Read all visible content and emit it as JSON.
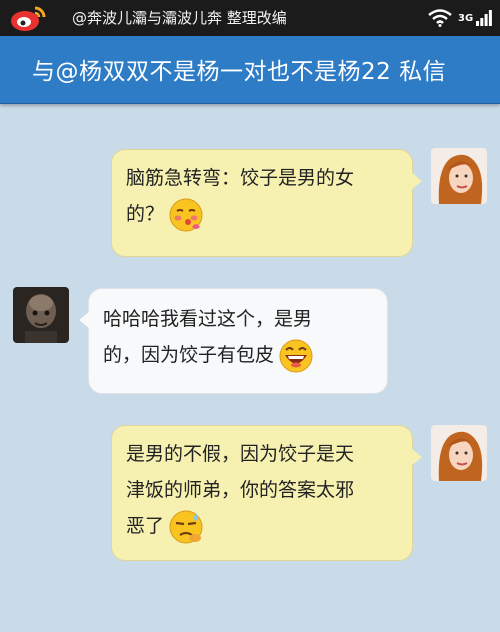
{
  "status_bar": {
    "text": "@奔波儿灞与灞波儿奔 整理改编",
    "network_label": "3G"
  },
  "header": {
    "title": "与@杨双双不是杨一对也不是杨22  私信"
  },
  "messages": [
    {
      "side": "right",
      "sender": "me",
      "lines": [
        "脑筋急转弯：饺子是男的女",
        "的？"
      ],
      "emoji": "shy-kiss-emoji"
    },
    {
      "side": "left",
      "sender": "other",
      "lines": [
        "哈哈哈我看过这个，是男",
        "的，因为饺子有包皮"
      ],
      "emoji": "laughing-emoji"
    },
    {
      "side": "right",
      "sender": "me",
      "lines": [
        "是男的不假，因为饺子是天",
        "津饭的师弟，你的答案太邪",
        "恶了"
      ],
      "emoji": "sweat-emoji"
    }
  ],
  "colors": {
    "background": "#c9dae8",
    "header": "#2e7cc6",
    "my_bubble": "#f6f1b1",
    "their_bubble": "#f7f9fb"
  }
}
